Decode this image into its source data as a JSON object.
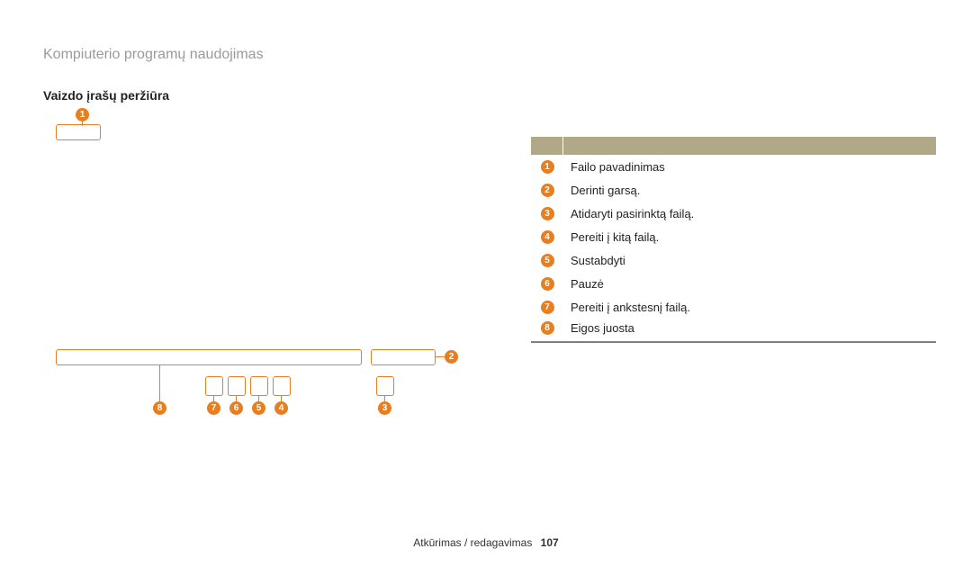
{
  "header": "Kompiuterio programų naudojimas",
  "section_title": "Vaizdo įrašų peržiūra",
  "callouts": {
    "c1": "1",
    "c2": "2",
    "c3": "3",
    "c4": "4",
    "c5": "5",
    "c6": "6",
    "c7": "7",
    "c8": "8"
  },
  "legend": [
    {
      "num": "1",
      "text": "Failo pavadinimas"
    },
    {
      "num": "2",
      "text": "Derinti garsą."
    },
    {
      "num": "3",
      "text": "Atidaryti pasirinktą failą."
    },
    {
      "num": "4",
      "text": "Pereiti į kitą failą."
    },
    {
      "num": "5",
      "text": "Sustabdyti"
    },
    {
      "num": "6",
      "text": "Pauzė"
    },
    {
      "num": "7",
      "text": "Pereiti į ankstesnį failą."
    },
    {
      "num": "8",
      "text": "Eigos juosta"
    }
  ],
  "footer": {
    "label": "Atkūrimas / redagavimas",
    "page": "107"
  }
}
